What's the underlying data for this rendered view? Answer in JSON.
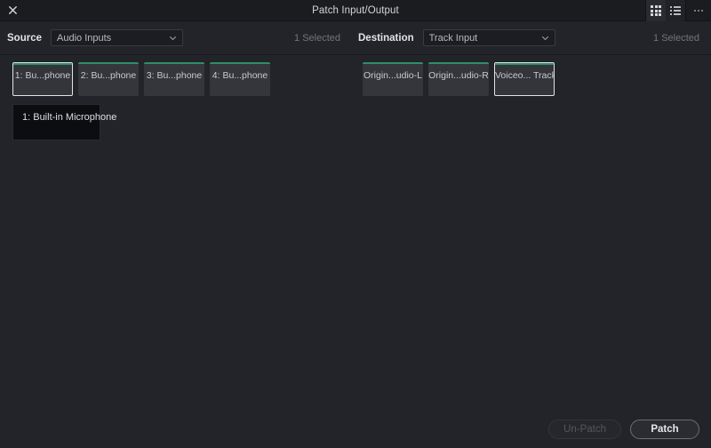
{
  "window": {
    "title": "Patch Input/Output",
    "close_icon": "close-icon",
    "view_grid_icon": "grid-view-icon",
    "view_list_icon": "list-view-icon",
    "overflow_icon": "more-options-icon"
  },
  "source": {
    "label": "Source",
    "dropdown_value": "Audio Inputs",
    "dropdown_placeholder": "Audio Inputs",
    "chevron_icon": "chevron-down-icon",
    "selected_count": "1 Selected",
    "tiles": [
      {
        "label": "1: Bu...phone",
        "selected": true
      },
      {
        "label": "2: Bu...phone",
        "selected": false
      },
      {
        "label": "3: Bu...phone",
        "selected": false
      },
      {
        "label": "4: Bu...phone",
        "selected": false
      }
    ],
    "tooltip": "1: Built-in Microphone"
  },
  "destination": {
    "label": "Destination",
    "dropdown_value": "Track Input",
    "dropdown_placeholder": "Track Input",
    "chevron_icon": "chevron-down-icon",
    "selected_count": "1 Selected",
    "tiles": [
      {
        "label": "Origin...udio-L",
        "selected": false
      },
      {
        "label": "Origin...udio-R",
        "selected": false
      },
      {
        "label": "Voiceo... Track",
        "selected": true
      }
    ]
  },
  "footer": {
    "unpatch_label": "Un-Patch",
    "patch_label": "Patch"
  },
  "colors": {
    "accent_green": "#2f8f66",
    "window_bg": "#232429",
    "titlebar_bg": "#1b1c20",
    "tile_bg": "#35363c",
    "selected_border": "#e2e3e6"
  }
}
